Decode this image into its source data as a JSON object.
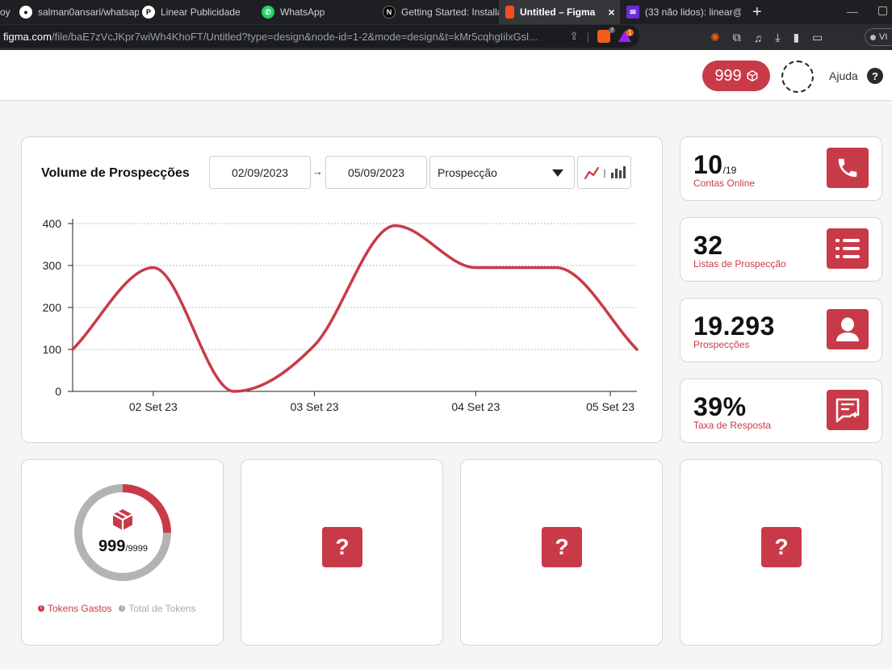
{
  "browser": {
    "tabs": [
      {
        "label": "oy",
        "icon": "partial-tab-icon",
        "active": false
      },
      {
        "label": "salman0ansari/whatsap",
        "icon": "github-icon",
        "active": false
      },
      {
        "label": "Linear Publicidade",
        "icon": "linear-icon",
        "active": false
      },
      {
        "label": "WhatsApp",
        "icon": "whatsapp-icon",
        "active": false
      },
      {
        "label": "Getting Started: Installa",
        "icon": "nextjs-icon",
        "active": false
      },
      {
        "label": "Untitled – Figma",
        "icon": "figma-icon",
        "active": true
      },
      {
        "label": "(33 não lidos): linear@",
        "icon": "mail-icon",
        "active": false
      }
    ],
    "close_glyph": "×",
    "new_tab_glyph": "+",
    "url_host": "figma.com",
    "url_path": "/file/baE7zVcJKpr7wiWh4KhoFT/Untitled?type=design&node-id=1-2&mode=design&t=kMr5cqhgIilxGsl...",
    "brave_count": "7",
    "rewards_count": "1",
    "vpn_label": "VI"
  },
  "header": {
    "token_count": "999",
    "help_label": "Ajuda",
    "help_glyph": "?"
  },
  "chart_card": {
    "title": "Volume de Prospecções",
    "start_date": "02/09/2023",
    "end_date": "05/09/2023",
    "range_arrow": "→",
    "filter_value": "Prospecção"
  },
  "chart_data": {
    "type": "line",
    "title": "Volume de Prospecções",
    "x": [
      0,
      1,
      2,
      3,
      4,
      5,
      6,
      7
    ],
    "x_tick_positions": [
      1,
      3,
      5,
      6.67
    ],
    "x_tick_labels": [
      "02 Set 23",
      "03 Set 23",
      "04 Set 23",
      "05 Set 23"
    ],
    "series": [
      {
        "values": [
          100,
          295,
          0,
          110,
          395,
          295,
          295,
          100
        ],
        "color": "#c93a48"
      }
    ],
    "ylim": [
      0,
      400
    ],
    "yticks": [
      0,
      100,
      200,
      300,
      400
    ],
    "xlim": [
      0,
      7
    ],
    "grid": true
  },
  "stats": [
    {
      "value": "10",
      "suffix": "/19",
      "label": "Contas Online",
      "icon": "phone-icon"
    },
    {
      "value": "32",
      "suffix": "",
      "label": "Listas de Prospecção",
      "icon": "list-icon"
    },
    {
      "value": "19.293",
      "suffix": "",
      "label": "Prospecções",
      "icon": "user-icon"
    },
    {
      "value": "39%",
      "suffix": "",
      "label": "Taxa de Resposta",
      "icon": "reply-icon"
    }
  ],
  "tokens_card": {
    "used": "999",
    "total": "/9999",
    "used_fraction": 0.25,
    "legend_used": "Tokens Gastos",
    "legend_total": "Total de Tokens"
  },
  "placeholder_cards": [
    {
      "glyph": "?"
    },
    {
      "glyph": "?"
    },
    {
      "glyph": "?"
    }
  ],
  "colors": {
    "accent": "#c93a48",
    "ring_track": "#b3b3b3",
    "muted_text": "#aaaaaa"
  }
}
